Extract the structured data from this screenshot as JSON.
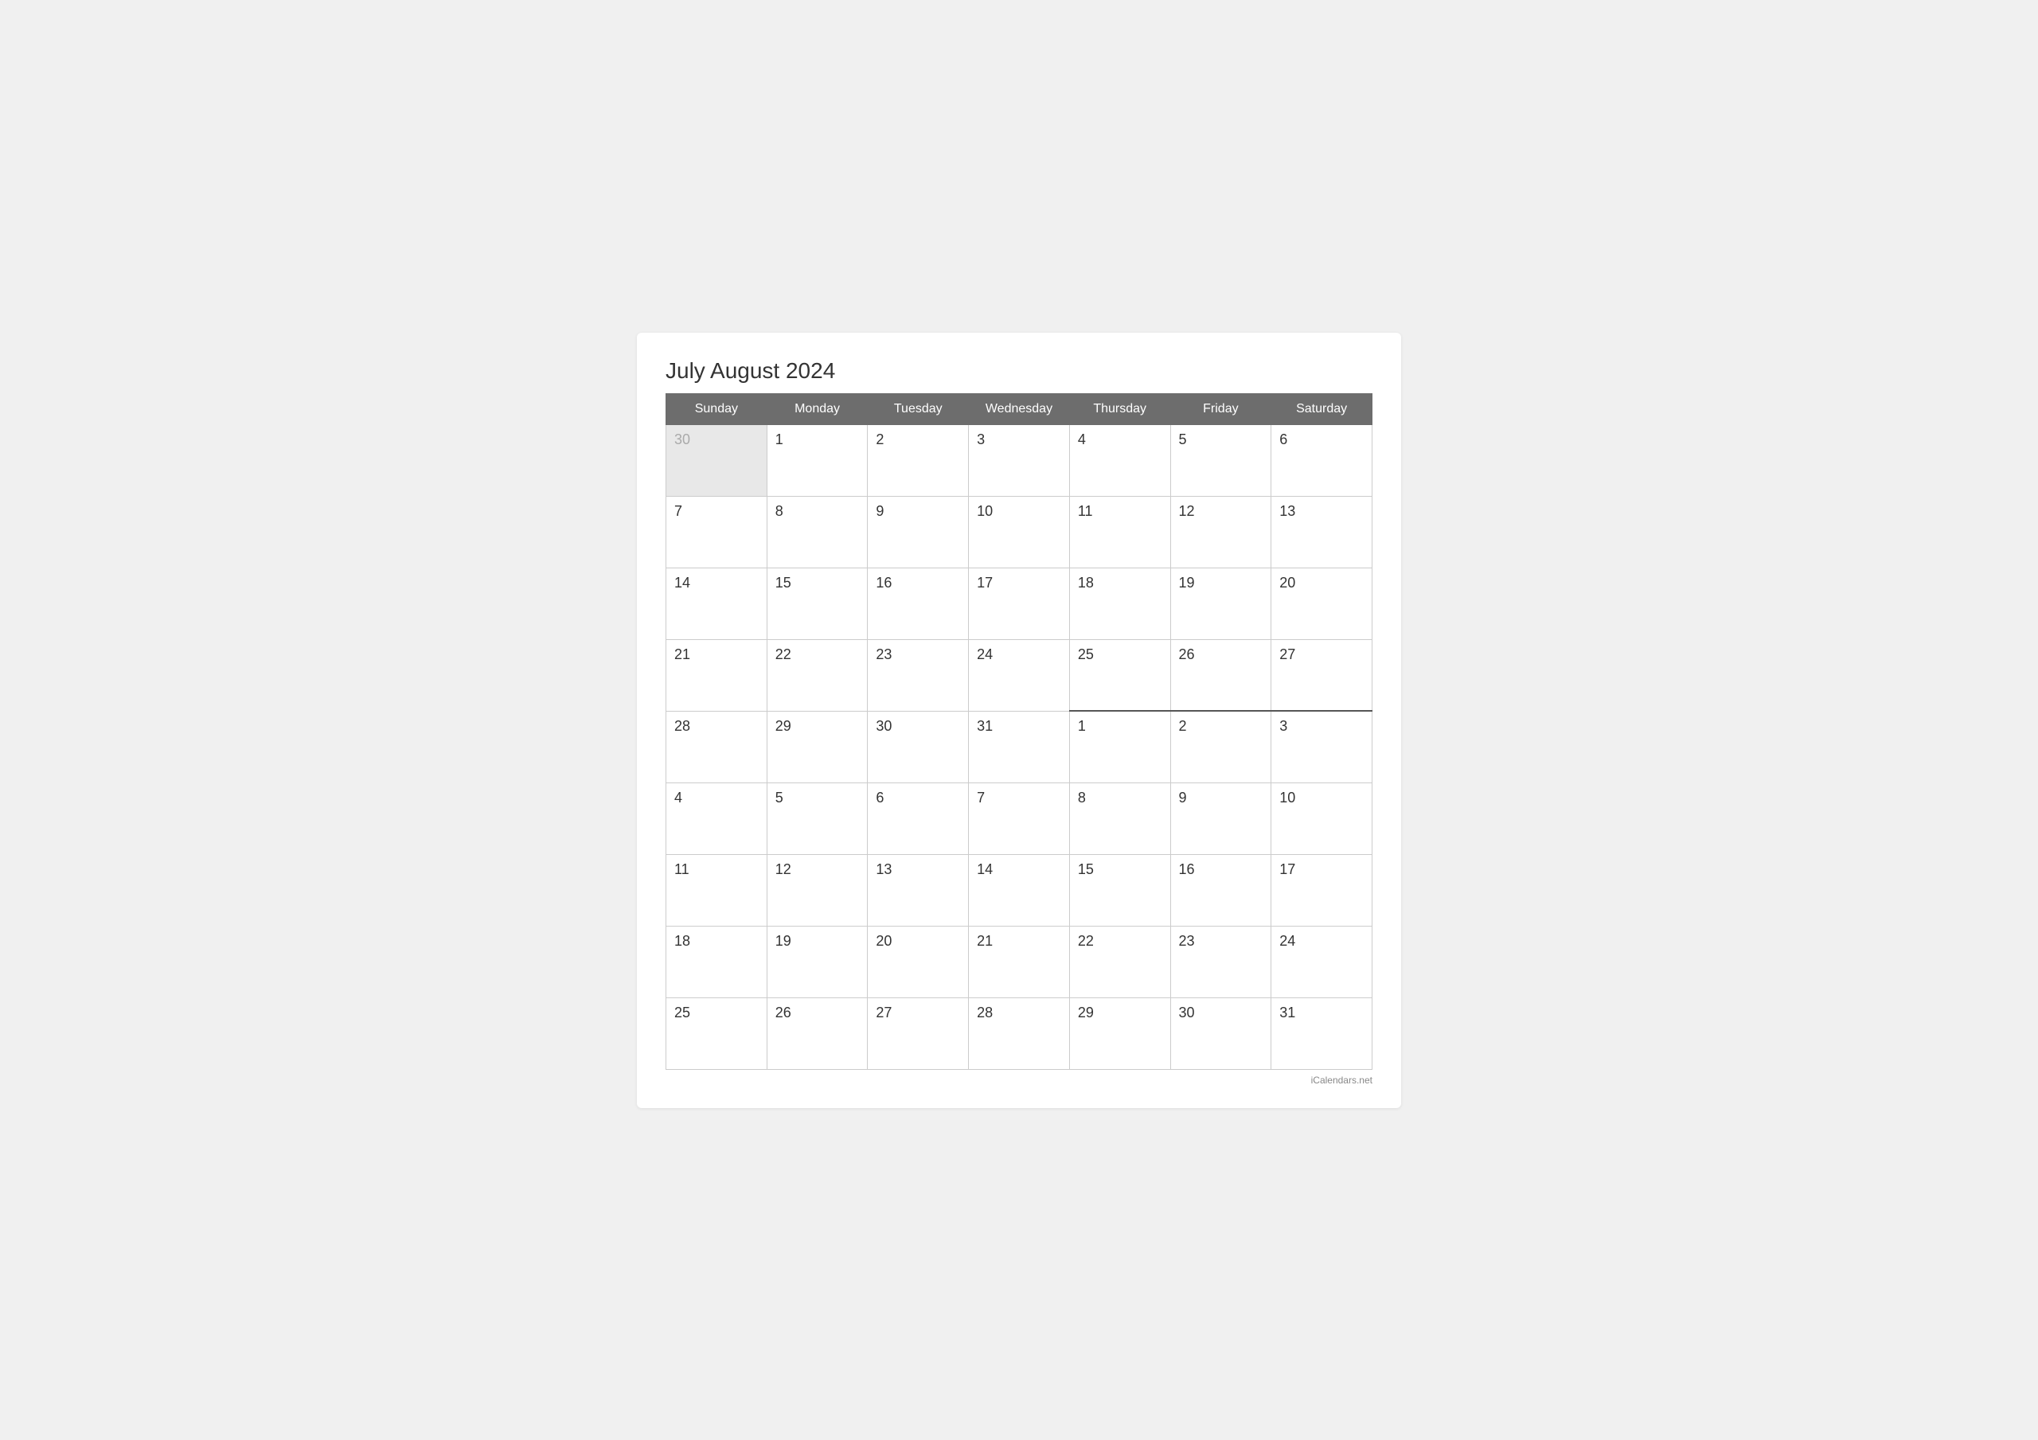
{
  "title": "July August 2024",
  "watermark": "iCalendars.net",
  "headers": [
    "Sunday",
    "Monday",
    "Tuesday",
    "Wednesday",
    "Thursday",
    "Friday",
    "Saturday"
  ],
  "rows": [
    [
      {
        "day": "30",
        "otherMonth": true
      },
      {
        "day": "1",
        "otherMonth": false
      },
      {
        "day": "2",
        "otherMonth": false
      },
      {
        "day": "3",
        "otherMonth": false
      },
      {
        "day": "4",
        "otherMonth": false
      },
      {
        "day": "5",
        "otherMonth": false
      },
      {
        "day": "6",
        "otherMonth": false
      }
    ],
    [
      {
        "day": "7",
        "otherMonth": false
      },
      {
        "day": "8",
        "otherMonth": false
      },
      {
        "day": "9",
        "otherMonth": false
      },
      {
        "day": "10",
        "otherMonth": false
      },
      {
        "day": "11",
        "otherMonth": false
      },
      {
        "day": "12",
        "otherMonth": false
      },
      {
        "day": "13",
        "otherMonth": false
      }
    ],
    [
      {
        "day": "14",
        "otherMonth": false
      },
      {
        "day": "15",
        "otherMonth": false
      },
      {
        "day": "16",
        "otherMonth": false
      },
      {
        "day": "17",
        "otherMonth": false
      },
      {
        "day": "18",
        "otherMonth": false
      },
      {
        "day": "19",
        "otherMonth": false
      },
      {
        "day": "20",
        "otherMonth": false
      }
    ],
    [
      {
        "day": "21",
        "otherMonth": false
      },
      {
        "day": "22",
        "otherMonth": false
      },
      {
        "day": "23",
        "otherMonth": false
      },
      {
        "day": "24",
        "otherMonth": false
      },
      {
        "day": "25",
        "otherMonth": false
      },
      {
        "day": "26",
        "otherMonth": false
      },
      {
        "day": "27",
        "otherMonth": false
      }
    ],
    [
      {
        "day": "28",
        "otherMonth": false
      },
      {
        "day": "29",
        "otherMonth": false
      },
      {
        "day": "30",
        "otherMonth": false
      },
      {
        "day": "31",
        "otherMonth": false
      },
      {
        "day": "1",
        "otherMonth": false,
        "transition": true
      },
      {
        "day": "2",
        "otherMonth": false,
        "transition": true
      },
      {
        "day": "3",
        "otherMonth": false,
        "transition": true
      }
    ],
    [
      {
        "day": "4",
        "otherMonth": false
      },
      {
        "day": "5",
        "otherMonth": false
      },
      {
        "day": "6",
        "otherMonth": false
      },
      {
        "day": "7",
        "otherMonth": false
      },
      {
        "day": "8",
        "otherMonth": false
      },
      {
        "day": "9",
        "otherMonth": false
      },
      {
        "day": "10",
        "otherMonth": false
      }
    ],
    [
      {
        "day": "11",
        "otherMonth": false
      },
      {
        "day": "12",
        "otherMonth": false
      },
      {
        "day": "13",
        "otherMonth": false
      },
      {
        "day": "14",
        "otherMonth": false
      },
      {
        "day": "15",
        "otherMonth": false
      },
      {
        "day": "16",
        "otherMonth": false
      },
      {
        "day": "17",
        "otherMonth": false
      }
    ],
    [
      {
        "day": "18",
        "otherMonth": false
      },
      {
        "day": "19",
        "otherMonth": false
      },
      {
        "day": "20",
        "otherMonth": false
      },
      {
        "day": "21",
        "otherMonth": false
      },
      {
        "day": "22",
        "otherMonth": false
      },
      {
        "day": "23",
        "otherMonth": false
      },
      {
        "day": "24",
        "otherMonth": false
      }
    ],
    [
      {
        "day": "25",
        "otherMonth": false
      },
      {
        "day": "26",
        "otherMonth": false
      },
      {
        "day": "27",
        "otherMonth": false
      },
      {
        "day": "28",
        "otherMonth": false
      },
      {
        "day": "29",
        "otherMonth": false
      },
      {
        "day": "30",
        "otherMonth": false
      },
      {
        "day": "31",
        "otherMonth": false
      }
    ]
  ]
}
